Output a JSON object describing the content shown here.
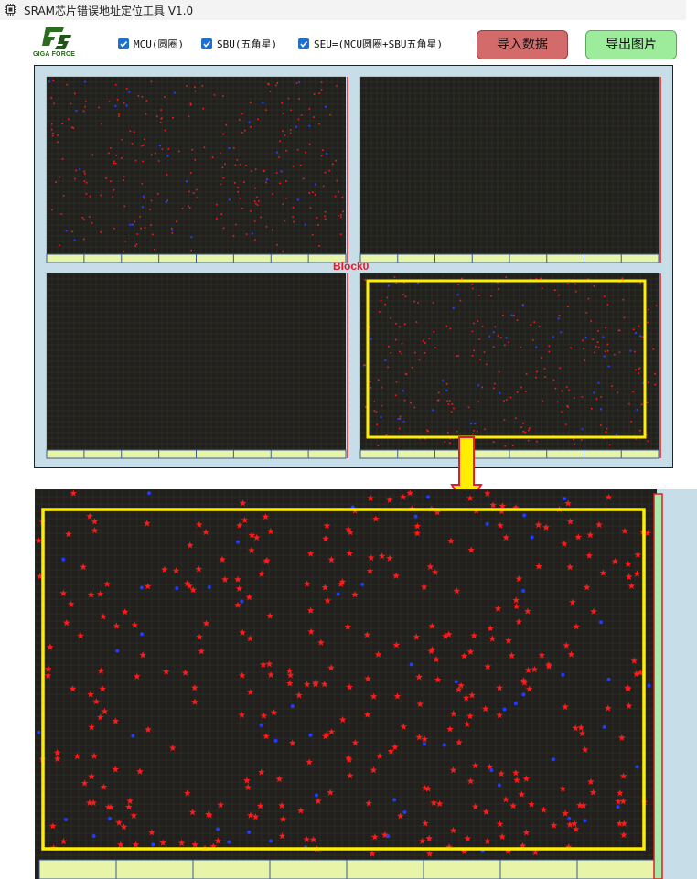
{
  "window": {
    "title": "SRAM芯片错误地址定位工具 V1.0",
    "app_icon": "chip-icon"
  },
  "logo": {
    "brand_text": "GIGA FORCE",
    "icon": "giga-force-logo"
  },
  "checkboxes": [
    {
      "label": "MCU(圆圈)",
      "checked": true
    },
    {
      "label": "SBU(五角星)",
      "checked": true
    },
    {
      "label": "SEU=(MCU圆圈+SBU五角星)",
      "checked": true
    }
  ],
  "buttons": {
    "import_label": "导入数据",
    "export_label": "导出图片"
  },
  "overview": {
    "selected_block_label": "Block0",
    "panels": 4
  },
  "colors": {
    "plot_bg": "#231f1e",
    "sbu_marker": "#ff1a1a",
    "mcu_marker": "#1f3cff",
    "highlight": "#ffee00",
    "scrollbar": "#e8f5a8",
    "arrow_fill": "#ffee00",
    "arrow_stroke": "#e8182a"
  }
}
